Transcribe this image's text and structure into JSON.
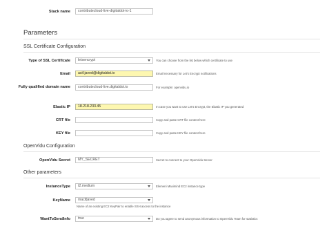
{
  "stack": {
    "label": "Stack name",
    "value": "contributecloud-live-digitaldot-io-1"
  },
  "parameters_title": "Parameters",
  "ssl": {
    "title": "SSL Certificate Configuration",
    "type_label": "Type of SSL Certificate",
    "type_value": "letsencrypt",
    "type_desc": "You can choose from the list below which certificate to use",
    "email_label": "Email",
    "email_value": "asif.javed@digitaldot.io",
    "email_desc": "Email necessary for Let's Encrypt notifications",
    "fqdn_label": "Fully qualified domain name",
    "fqdn_value": "contributecloud-live.digitaldot.io",
    "fqdn_desc": "For example: openvidu.io",
    "eip_label": "Elastic IP",
    "eip_value": "18.218.233.45",
    "eip_desc": "In case you want to use Let's Encrypt, the Elastic IP you generated",
    "crt_label": "CRT file",
    "crt_value": "",
    "crt_desc": "Copy and paste CRT file content here",
    "key_label": "KEY file",
    "key_value": "",
    "key_desc": "Copy and paste KEY file content here"
  },
  "openvidu": {
    "title": "OpenVidu Configuration",
    "secret_label": "OpenVidu Secret",
    "secret_value": "MY_SECRET",
    "secret_desc": "Secret to connect to your OpenVidu Server"
  },
  "other": {
    "title": "Other parameters",
    "instance_label": "InstanceType",
    "instance_value": "t2.medium",
    "instance_desc": "Elemeni Maximind EC2 instance type",
    "keyname_label": "KeyName",
    "keyname_value": "macifjaved",
    "keyname_desc": "Name of an existing EC2 KeyPair to enable SSH access to the instance",
    "send_label": "WantToSendInfo",
    "send_value": "true",
    "send_desc": "Do you agree to send anonymous information to OpenVidu Team for statistics"
  }
}
